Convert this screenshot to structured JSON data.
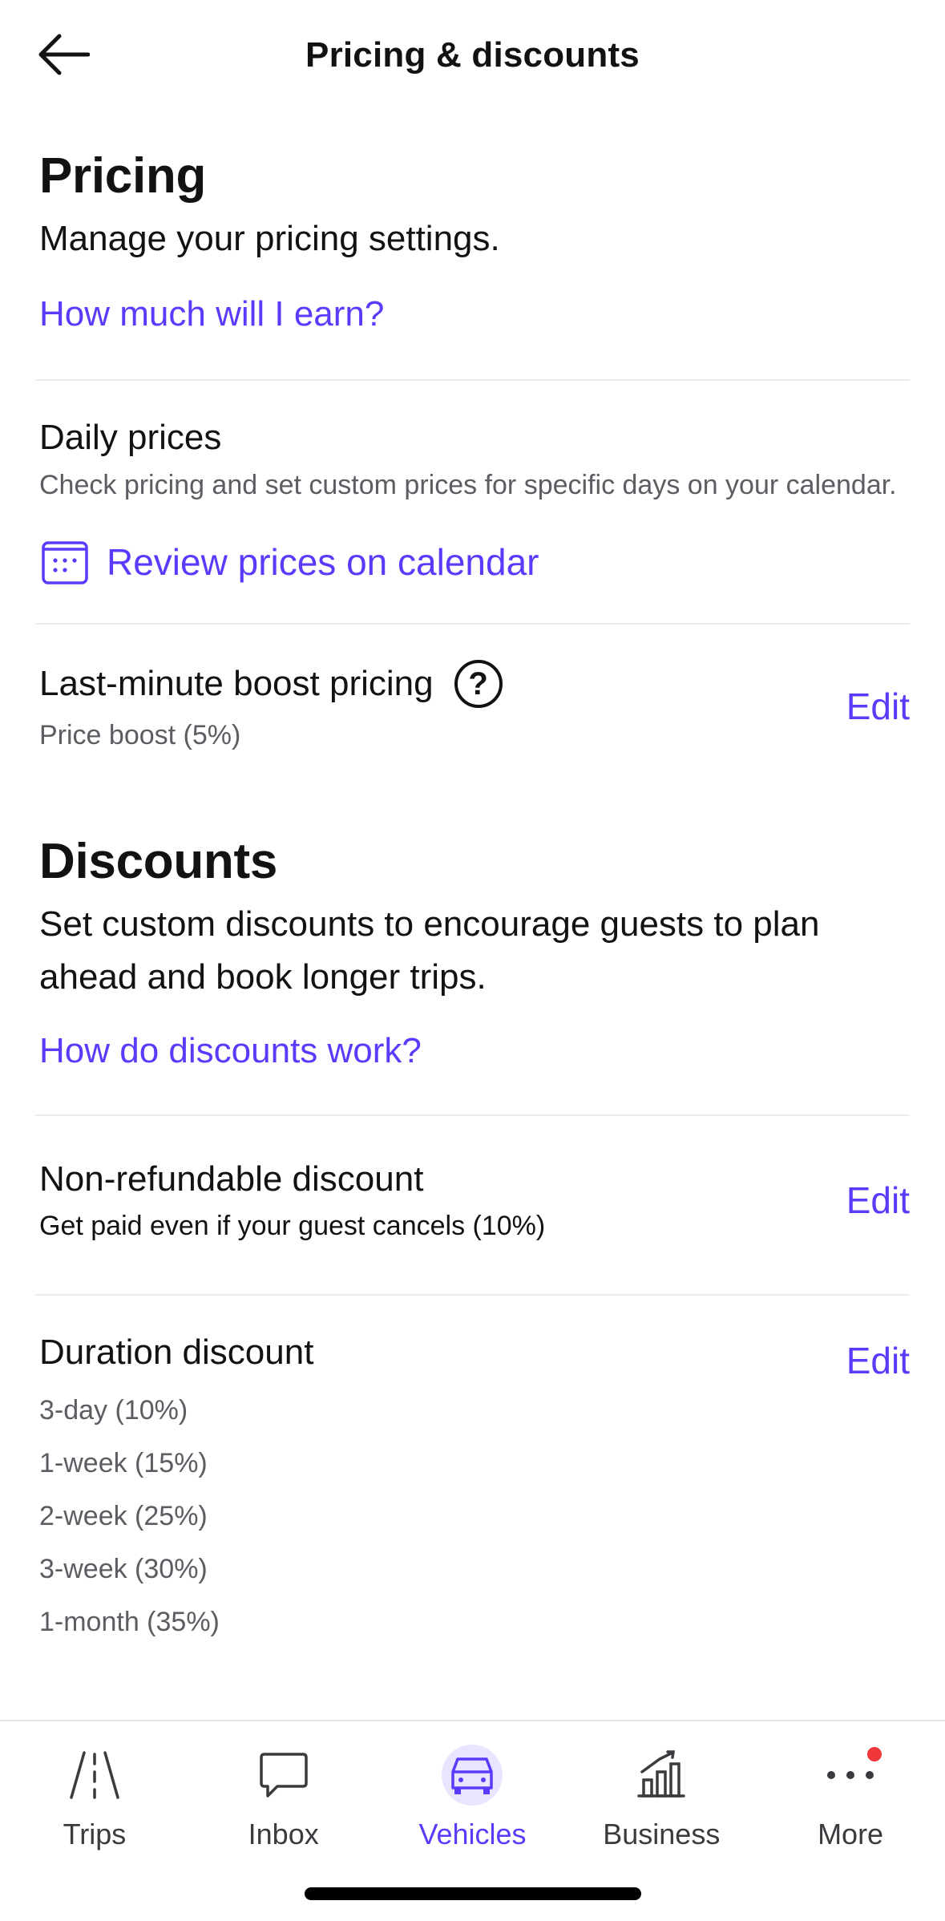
{
  "header": {
    "title": "Pricing & discounts"
  },
  "pricing": {
    "heading": "Pricing",
    "subtitle": "Manage your pricing settings.",
    "help_link": "How much will I earn?",
    "daily_prices": {
      "title": "Daily prices",
      "description": "Check pricing and set custom prices for specific days on your calendar.",
      "calendar_link": "Review prices on calendar"
    },
    "boost": {
      "title": "Last-minute boost pricing",
      "help_glyph": "?",
      "value": "Price boost (5%)",
      "edit_label": "Edit"
    }
  },
  "discounts": {
    "heading": "Discounts",
    "subtitle": "Set custom discounts to encourage guests to plan ahead and book longer trips.",
    "help_link": "How do discounts work?",
    "non_refundable": {
      "title": "Non-refundable discount",
      "value": "Get paid even if your guest cancels (10%)",
      "edit_label": "Edit"
    },
    "duration": {
      "title": "Duration discount",
      "edit_label": "Edit",
      "items": [
        "3-day (10%)",
        "1-week (15%)",
        "2-week (25%)",
        "3-week (30%)",
        "1-month (35%)"
      ]
    }
  },
  "nav": {
    "items": [
      {
        "label": "Trips",
        "icon": "road-icon"
      },
      {
        "label": "Inbox",
        "icon": "chat-icon"
      },
      {
        "label": "Vehicles",
        "icon": "car-icon",
        "active": true
      },
      {
        "label": "Business",
        "icon": "chart-icon"
      },
      {
        "label": "More",
        "icon": "more-dots-icon",
        "badge": true
      }
    ]
  },
  "colors": {
    "accent": "#593cfb",
    "badge": "#f0383a",
    "active_bg": "#e9e4ff"
  }
}
